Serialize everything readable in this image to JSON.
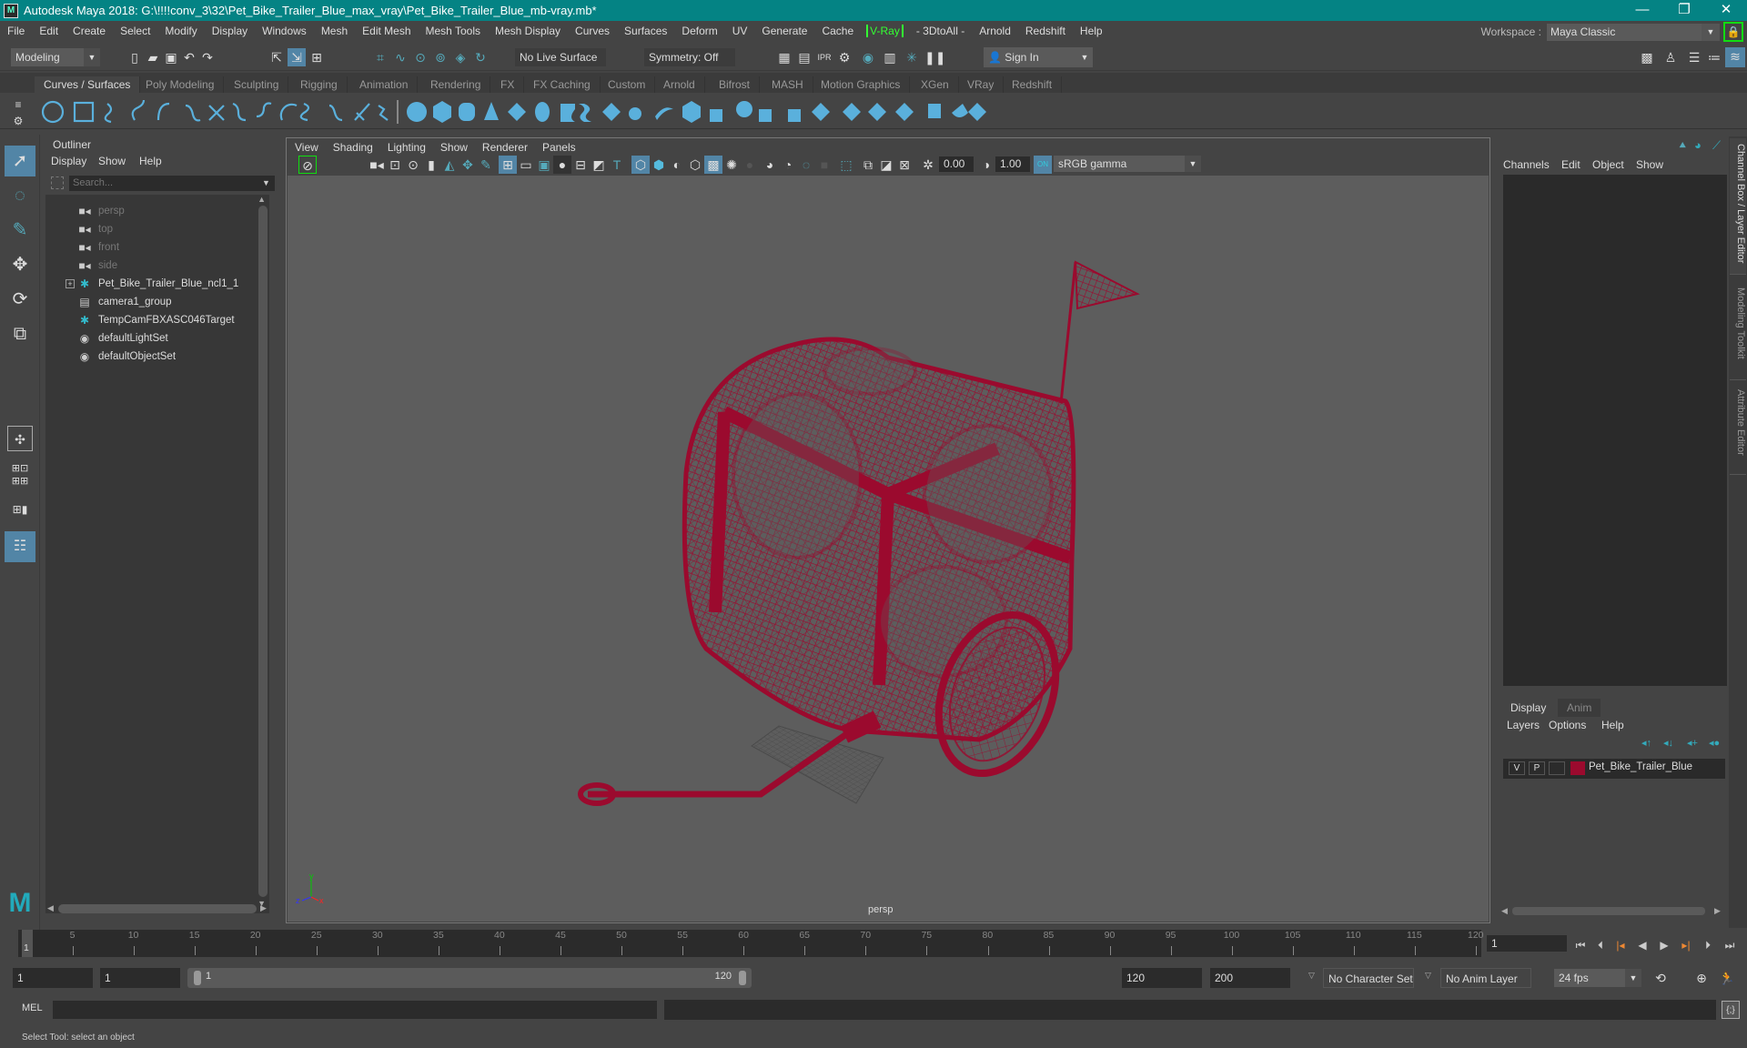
{
  "window": {
    "title": "Autodesk Maya 2018: G:\\!!!!conv_3\\32\\Pet_Bike_Trailer_Blue_max_vray\\Pet_Bike_Trailer_Blue_mb-vray.mb*",
    "controls": {
      "minimize": "—",
      "maximize": "❐",
      "close": "✕"
    }
  },
  "menubar": {
    "items": [
      "File",
      "Edit",
      "Create",
      "Select",
      "Modify",
      "Display",
      "Windows",
      "Mesh",
      "Edit Mesh",
      "Mesh Tools",
      "Mesh Display",
      "Curves",
      "Surfaces",
      "Deform",
      "UV",
      "Generate",
      "Cache"
    ],
    "vray": "V-Ray",
    "items_after": [
      "- 3DtoAll -",
      "Arnold",
      "Redshift",
      "Help"
    ],
    "workspace_label": "Workspace :",
    "workspace_value": "Maya Classic"
  },
  "statusline": {
    "mode": "Modeling",
    "live_surface": "No Live Surface",
    "symmetry": "Symmetry: Off",
    "sign_in": "Sign In"
  },
  "shelf": {
    "tabs": [
      "Curves / Surfaces",
      "Poly Modeling",
      "Sculpting",
      "Rigging",
      "Animation",
      "Rendering",
      "FX",
      "FX Caching",
      "Custom",
      "Arnold",
      "Bifrost",
      "MASH",
      "Motion Graphics",
      "XGen",
      "VRay",
      "Redshift"
    ],
    "active_tab": "Curves / Surfaces"
  },
  "outliner": {
    "title": "Outliner",
    "menu": [
      "Display",
      "Show",
      "Help"
    ],
    "search_placeholder": "Search...",
    "items": [
      {
        "label": "persp",
        "icon": "camera-icon",
        "dim": true
      },
      {
        "label": "top",
        "icon": "camera-icon",
        "dim": true
      },
      {
        "label": "front",
        "icon": "camera-icon",
        "dim": true
      },
      {
        "label": "side",
        "icon": "camera-icon",
        "dim": true
      },
      {
        "label": "Pet_Bike_Trailer_Blue_ncl1_1",
        "icon": "locator-icon",
        "expandable": true
      },
      {
        "label": "camera1_group",
        "icon": "group-icon"
      },
      {
        "label": "TempCamFBXASC046Target",
        "icon": "locator-icon"
      },
      {
        "label": "defaultLightSet",
        "icon": "set-icon"
      },
      {
        "label": "defaultObjectSet",
        "icon": "set-icon"
      }
    ]
  },
  "viewport": {
    "menu": [
      "View",
      "Shading",
      "Lighting",
      "Show",
      "Renderer",
      "Panels"
    ],
    "exposure": "0.00",
    "gamma": "1.00",
    "color_space": "sRGB gamma",
    "camera_label": "persp",
    "wire_color": "#9b0a2e",
    "axis": {
      "x": "x",
      "y": "y",
      "z": "z"
    }
  },
  "channelbox": {
    "menu": [
      "Channels",
      "Edit",
      "Object",
      "Show"
    ],
    "side_tabs": [
      "Channel Box / Layer Editor",
      "Modeling Toolkit",
      "Attribute Editor"
    ]
  },
  "layereditor": {
    "tabs": [
      "Display",
      "Anim"
    ],
    "menu": [
      "Layers",
      "Options",
      "Help"
    ],
    "layers": [
      {
        "v": "V",
        "p": "P",
        "name": "Pet_Bike_Trailer_Blue",
        "color": "#9b0a2e"
      }
    ]
  },
  "timeline": {
    "ticks": [
      "5",
      "10",
      "15",
      "20",
      "25",
      "30",
      "35",
      "40",
      "45",
      "50",
      "55",
      "60",
      "65",
      "70",
      "75",
      "80",
      "85",
      "90",
      "95",
      "100",
      "105",
      "110",
      "115",
      "120"
    ],
    "current_frame_marker": "1",
    "current_frame": "1"
  },
  "range": {
    "start": "1",
    "playback_start": "1",
    "slider_start": "1",
    "slider_end": "120",
    "playback_end": "120",
    "end": "200",
    "character_set": "No Character Set",
    "anim_layer": "No Anim Layer",
    "fps": "24 fps"
  },
  "cmdline": {
    "label": "MEL"
  },
  "helpline": {
    "text": "Select Tool: select an object"
  }
}
